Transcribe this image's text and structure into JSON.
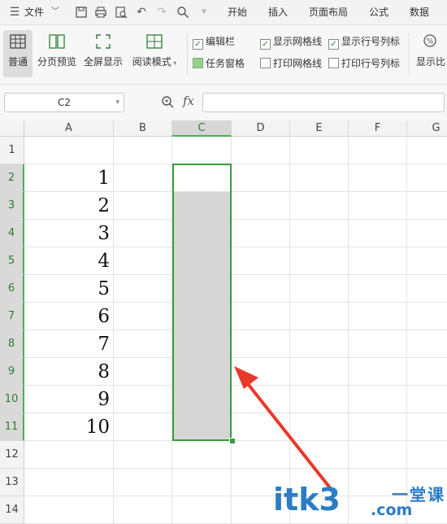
{
  "menu": {
    "file_label": "文件",
    "tabs": [
      "开始",
      "插入",
      "页面布局",
      "公式",
      "数据"
    ]
  },
  "toolbar": {
    "buttons": [
      {
        "label": "普通",
        "icon": "grid-view-icon",
        "active": true
      },
      {
        "label": "分页预览",
        "icon": "page-break-icon"
      },
      {
        "label": "全屏显示",
        "icon": "fullscreen-icon"
      },
      {
        "label": "阅读模式",
        "icon": "reading-mode-icon"
      }
    ],
    "checkboxes": [
      {
        "label": "编辑栏",
        "checked": true
      },
      {
        "label": "任务窗格",
        "checked": false,
        "filled": true
      },
      {
        "label": "显示网格线",
        "checked": true
      },
      {
        "label": "打印网格线",
        "checked": false
      },
      {
        "label": "显示行号列标",
        "checked": true
      },
      {
        "label": "打印行号列标",
        "checked": false
      }
    ],
    "zoom_label": "显示比"
  },
  "formula_bar": {
    "name_box": "C2",
    "fx_label": "fx",
    "formula": ""
  },
  "sheet": {
    "columns": [
      "A",
      "B",
      "C",
      "D",
      "E",
      "F",
      "G"
    ],
    "selected_column": "C",
    "rows": [
      "1",
      "2",
      "3",
      "4",
      "5",
      "6",
      "7",
      "8",
      "9",
      "10",
      "11",
      "12",
      "13",
      "14"
    ],
    "column_a_values": [
      "",
      "1",
      "2",
      "3",
      "4",
      "5",
      "6",
      "7",
      "8",
      "9",
      "10",
      "",
      "",
      ""
    ],
    "selection": "C2:C11"
  },
  "watermark": {
    "main": "itk3",
    "side": "一堂课",
    "com": ".com"
  },
  "colors": {
    "selection": "#3a9a3f",
    "annotation_arrow": "#e8392b",
    "watermark": "#2c7cc6"
  }
}
